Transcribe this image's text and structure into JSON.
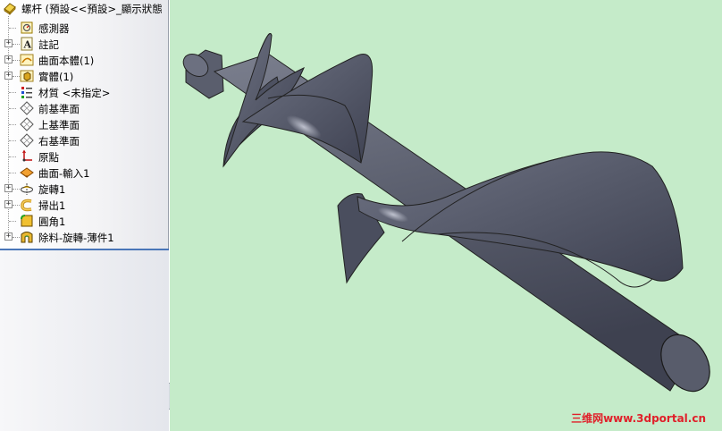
{
  "feature_tree": {
    "root": {
      "label": "螺杆 (預設<<預設>_顯示狀態",
      "icon": "part-icon"
    },
    "items": [
      {
        "label": "感測器",
        "icon": "sensor-icon",
        "expandable": false
      },
      {
        "label": "註記",
        "icon": "annotation-icon",
        "expandable": true
      },
      {
        "label": "曲面本體(1)",
        "icon": "surface-bodies-icon",
        "expandable": true
      },
      {
        "label": "實體(1)",
        "icon": "solid-bodies-icon",
        "expandable": true
      },
      {
        "label": "材質 <未指定>",
        "icon": "material-icon",
        "expandable": false
      },
      {
        "label": "前基準面",
        "icon": "plane-icon",
        "expandable": false
      },
      {
        "label": "上基準面",
        "icon": "plane-icon",
        "expandable": false
      },
      {
        "label": "右基準面",
        "icon": "plane-icon",
        "expandable": false
      },
      {
        "label": "原點",
        "icon": "origin-icon",
        "expandable": false
      },
      {
        "label": "曲面-輸入1",
        "icon": "imported-surface-icon",
        "expandable": false
      },
      {
        "label": "旋轉1",
        "icon": "revolve-icon",
        "expandable": true
      },
      {
        "label": "掃出1",
        "icon": "sweep-icon",
        "expandable": true
      },
      {
        "label": "圓角1",
        "icon": "fillet-icon",
        "expandable": false
      },
      {
        "label": "除料-旋轉-薄件1",
        "icon": "cut-revolve-thin-icon",
        "expandable": true
      }
    ]
  },
  "viewport": {
    "background_color": "#c5ebc9",
    "model_color": "#5d6170",
    "watermark": "三维网www.3dportal.cn"
  }
}
